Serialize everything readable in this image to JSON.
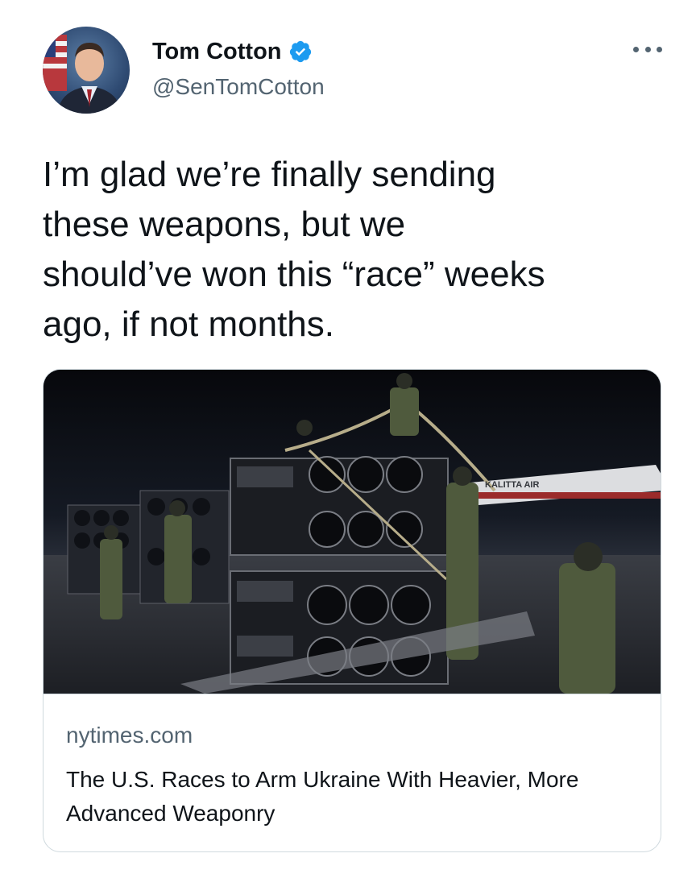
{
  "author": {
    "display_name": "Tom Cotton",
    "handle": "@SenTomCotton",
    "verified": true
  },
  "icons": {
    "verified": "verified-badge-icon",
    "more": "more-options-icon"
  },
  "tweet": {
    "text": "I’m glad we’re finally sending\nthese weapons, but we\nshould’ve won this “race” weeks\nago, if not months."
  },
  "link_card": {
    "domain": "nytimes.com",
    "title": "The U.S. Races to Arm Ukraine With Heavier, More Advanced Weaponry",
    "image_text": "KALITTA AIR"
  },
  "colors": {
    "text_primary": "#0f1419",
    "text_secondary": "#536471",
    "verified_blue": "#1d9bf0",
    "card_border": "#cfd9de"
  }
}
